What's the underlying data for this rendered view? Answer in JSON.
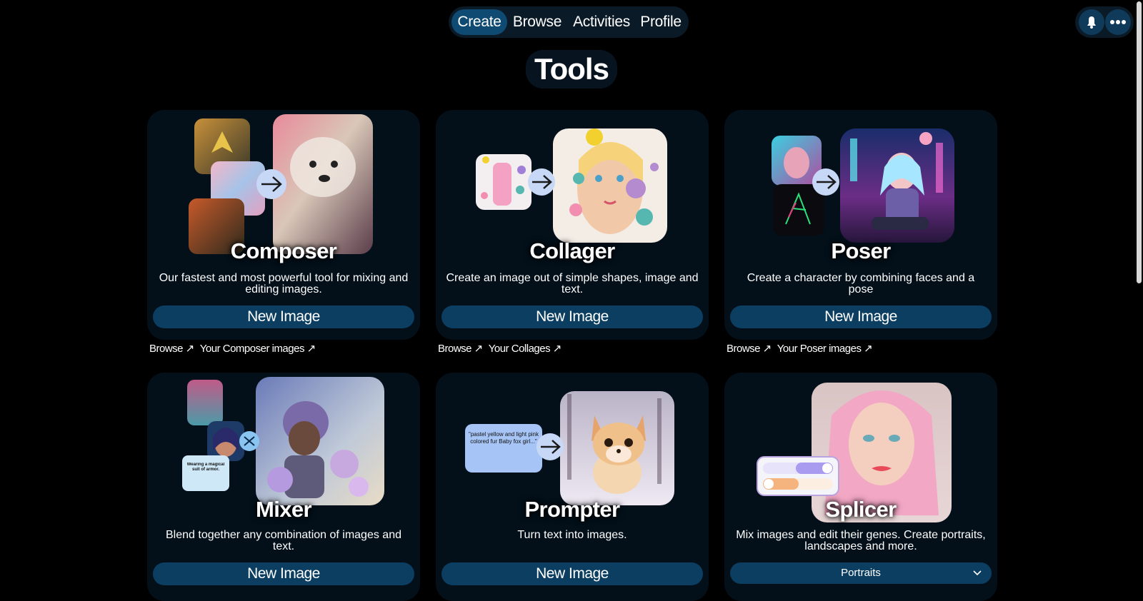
{
  "nav": {
    "tabs": [
      {
        "label": "Create"
      },
      {
        "label": "Browse"
      },
      {
        "label": "Activities"
      },
      {
        "label": "Profile"
      }
    ],
    "active": "Create"
  },
  "header_icons": [
    "bell-icon",
    "more-horizontal-icon"
  ],
  "page": {
    "title": "Tools"
  },
  "tools": [
    {
      "name": "Composer",
      "description": "Our fastest and most powerful tool for mixing and editing images.",
      "button": "New Image",
      "links": [
        "Browse ↗",
        "Your Composer images ↗"
      ]
    },
    {
      "name": "Collager",
      "description": "Create an image out of simple shapes, image and text.",
      "button": "New Image",
      "links": [
        "Browse ↗",
        "Your Collages ↗"
      ]
    },
    {
      "name": "Poser",
      "description": "Create a character by combining faces and a pose",
      "button": "New Image",
      "links": [
        "Browse ↗",
        "Your Poser images ↗"
      ]
    },
    {
      "name": "Mixer",
      "description": "Blend together any combination of images and text.",
      "button": "New Image",
      "art_caption": "Wearing a magical suit of armor."
    },
    {
      "name": "Prompter",
      "description": "Turn text into images.",
      "button": "New Image",
      "art_caption": "\"pastel yellow and light pink colored fur Baby fox girl...\""
    },
    {
      "name": "Splicer",
      "description": "Mix images and edit their genes. Create portraits, landscapes and more.",
      "select": "Portraits"
    }
  ],
  "colors": {
    "background": "#000000",
    "card": "#03101a",
    "button": "#0b3e60",
    "active_tab": "#0f4a73"
  }
}
